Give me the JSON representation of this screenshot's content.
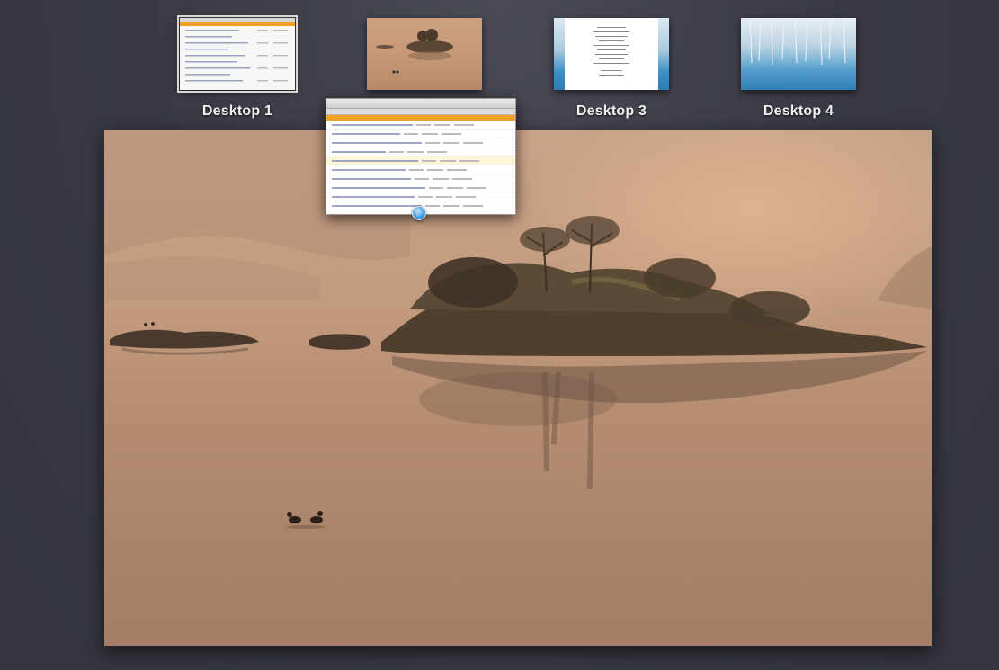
{
  "spaces": {
    "desktops": [
      {
        "label": "Desktop 1",
        "active": true,
        "thumb": "browser-window"
      },
      {
        "label": "",
        "active": false,
        "thumb": "sunset-lake"
      },
      {
        "label": "Desktop 3",
        "active": false,
        "thumb": "ice-document"
      },
      {
        "label": "Desktop 4",
        "active": false,
        "thumb": "ice-forest"
      }
    ]
  },
  "main_desktop": {
    "wallpaper": "misty-lake-island-at-dawn"
  },
  "dragged_window": {
    "app_icon": "safari-icon"
  },
  "colors": {
    "background": "#3a3b44",
    "label_text": "#f2f2f2",
    "browser_tab_accent": "#f2a127"
  }
}
